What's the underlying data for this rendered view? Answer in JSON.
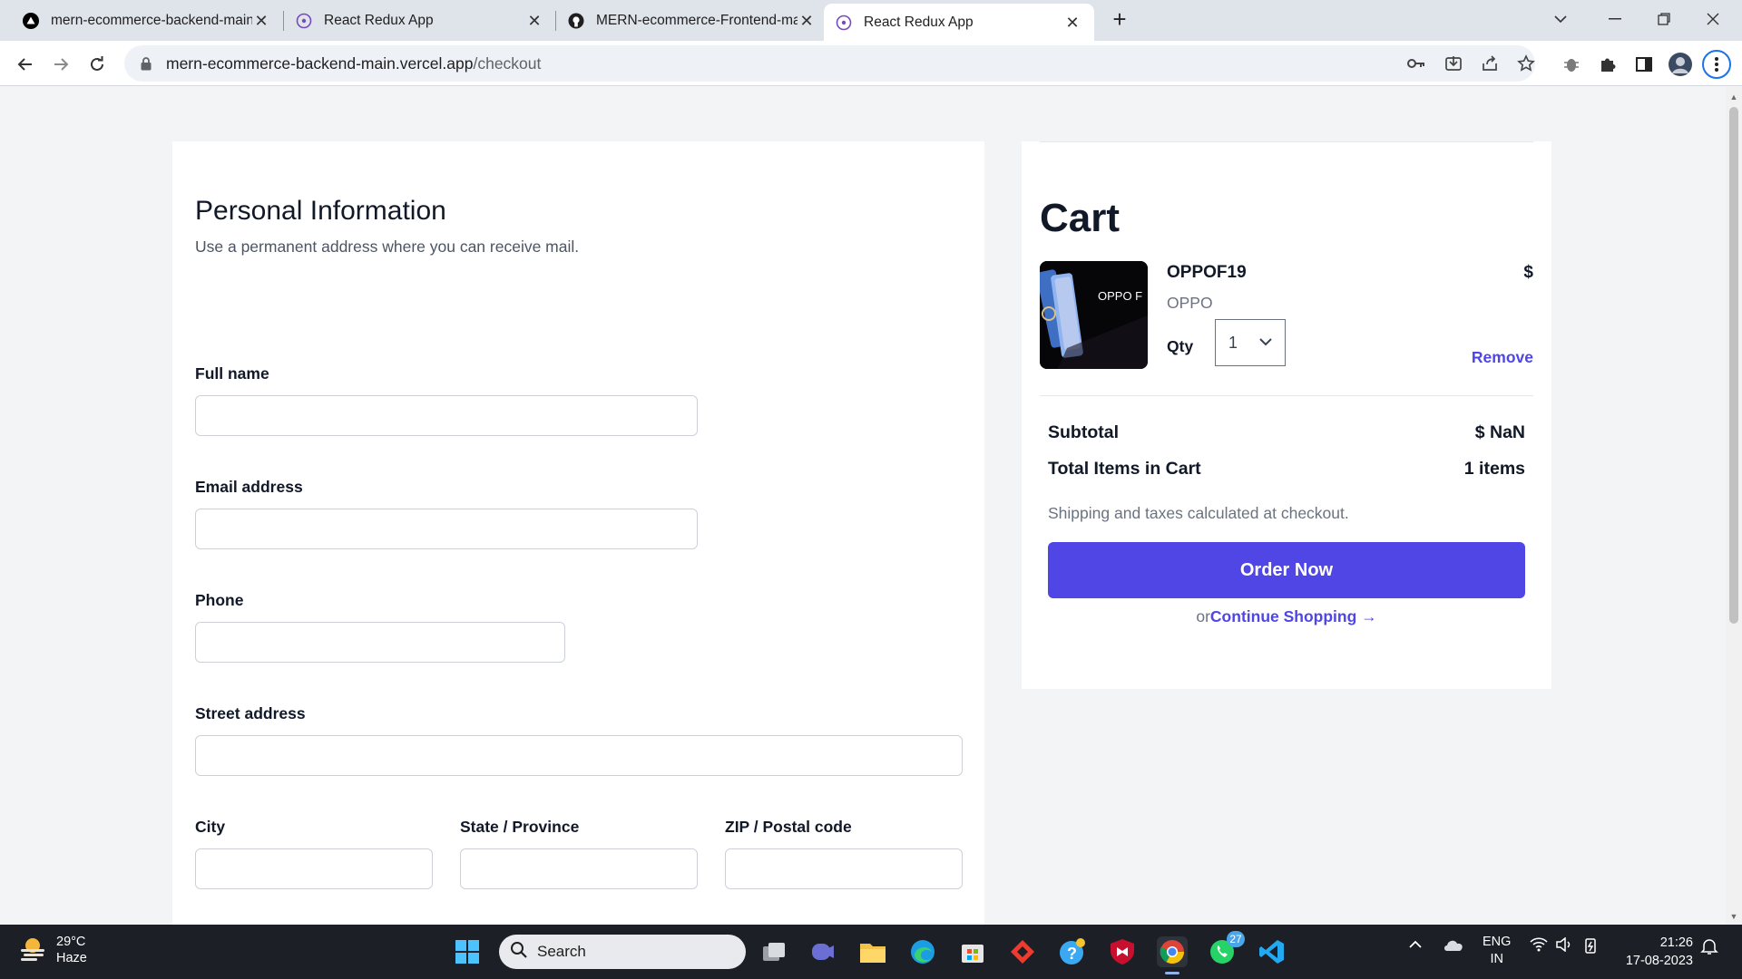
{
  "browser": {
    "tabs": [
      {
        "title": "mern-ecommerce-backend-main",
        "icon": "vercel-icon"
      },
      {
        "title": "React Redux App",
        "icon": "redux-icon"
      },
      {
        "title": "MERN-ecommerce-Frontend-ma",
        "icon": "github-icon"
      },
      {
        "title": "React Redux App",
        "icon": "redux-icon"
      }
    ],
    "url_host": "mern-ecommerce-backend-main.vercel.app",
    "url_path": "/checkout"
  },
  "form": {
    "title": "Personal Information",
    "subtitle": "Use a permanent address where you can receive mail.",
    "fields": {
      "full_name": {
        "label": "Full name",
        "value": ""
      },
      "email": {
        "label": "Email address",
        "value": ""
      },
      "phone": {
        "label": "Phone",
        "value": ""
      },
      "street": {
        "label": "Street address",
        "value": ""
      },
      "city": {
        "label": "City",
        "value": ""
      },
      "state": {
        "label": "State / Province",
        "value": ""
      },
      "zip": {
        "label": "ZIP / Postal code",
        "value": ""
      }
    }
  },
  "cart": {
    "title": "Cart",
    "item": {
      "name": "OPPOF19",
      "brand": "OPPO",
      "price": "$",
      "qty_label": "Qty",
      "qty_value": "1",
      "remove_label": "Remove",
      "image_text": "OPPO F"
    },
    "subtotal_label": "Subtotal",
    "subtotal_value": "$ NaN",
    "total_items_label": "Total Items in Cart",
    "total_items_value": "1 items",
    "shipping_note": "Shipping and taxes calculated at checkout.",
    "order_button": "Order Now",
    "continue_prefix": "or",
    "continue_link": "Continue Shopping →"
  },
  "taskbar": {
    "weather_temp": "29°C",
    "weather_desc": "Haze",
    "search_label": "Search",
    "whatsapp_badge": "27",
    "lang_top": "ENG",
    "lang_bottom": "IN",
    "time": "21:26",
    "date": "17-08-2023"
  },
  "colors": {
    "accent": "#4f46e5",
    "page_bg": "#f3f4f6",
    "taskbar_bg": "#1c1f26",
    "tabbar_bg": "#dfe3ea"
  }
}
